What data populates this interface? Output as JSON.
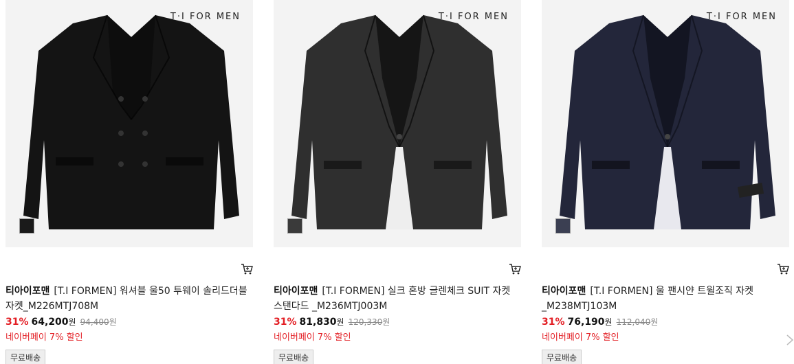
{
  "products": [
    {
      "logo_text": "T·I FOR MEN",
      "swatch_color": "#1a1a1a",
      "jacket_color": "#141414",
      "jacket_style": "double-breasted",
      "brand": "티아이포맨",
      "name": "[T.I FORMEN] 워셔블 울50 투웨이 솔리드더블 자켓_M226MTJ708M",
      "discount_rate": "31%",
      "price": "64,200",
      "price_unit": "원",
      "original_price": "94,400",
      "original_unit": "원",
      "npay": "네이버페이 7% 할인",
      "badge": "무료배송",
      "cart_icon": "cart-icon"
    },
    {
      "logo_text": "T·I FOR MEN",
      "swatch_color": "#3a3a3a",
      "jacket_color": "#2f2f2f",
      "jacket_style": "single-breasted",
      "brand": "티아이포맨",
      "name": "[T.I FORMEN] 실크 혼방 글렌체크 SUIT 자켓 스탠다드 _M236MTJ003M",
      "discount_rate": "31%",
      "price": "81,830",
      "price_unit": "원",
      "original_price": "120,330",
      "original_unit": "원",
      "npay": "네이버페이 7% 할인",
      "badge": "무료배송",
      "cart_icon": "cart-icon"
    },
    {
      "logo_text": "T·I FOR MEN",
      "swatch_color": "#3b3f52",
      "jacket_color": "#23263a",
      "jacket_style": "single-breasted",
      "brand": "티아이포맨",
      "name": "[T.I FORMEN] 울 팬시얀 트윌조직 자켓 _M238MTJ103M",
      "discount_rate": "31%",
      "price": "76,190",
      "price_unit": "원",
      "original_price": "112,040",
      "original_unit": "원",
      "npay": "네이버페이 7% 할인",
      "badge": "무료배송",
      "cart_icon": "cart-icon"
    }
  ]
}
